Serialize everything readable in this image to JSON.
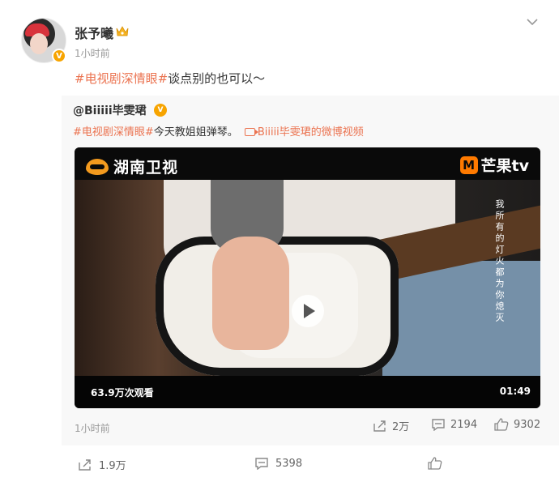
{
  "user": {
    "name": "张予曦",
    "time": "1小时前",
    "verified_mark": "V"
  },
  "post": {
    "tag": "#电视剧深情眼#",
    "text": "谈点别的也可以～"
  },
  "repost": {
    "author": "@Biiiii毕雯珺",
    "verified_mark": "V",
    "tag": "#电视剧深情眼#",
    "text": "今天教姐姐弹琴。",
    "video_link": "Biiiii毕雯珺的微博视频",
    "time": "1小时前",
    "actions": {
      "repost_count": "2万",
      "comment_count": "2194",
      "like_count": "9302"
    }
  },
  "video": {
    "channel_logo": "湖南卫视",
    "platform_logo": "芒果tv",
    "platform_mark": "M",
    "lyrics": "我所有的灯火都为你熄灭",
    "views": "63.9万次观看",
    "duration": "01:49"
  },
  "bottom": {
    "repost_count": "1.9万",
    "comment_count": "5398"
  },
  "colors": {
    "accent": "#eb7350",
    "badge": "#f7a400",
    "repost_bg": "#f8f8f8"
  }
}
